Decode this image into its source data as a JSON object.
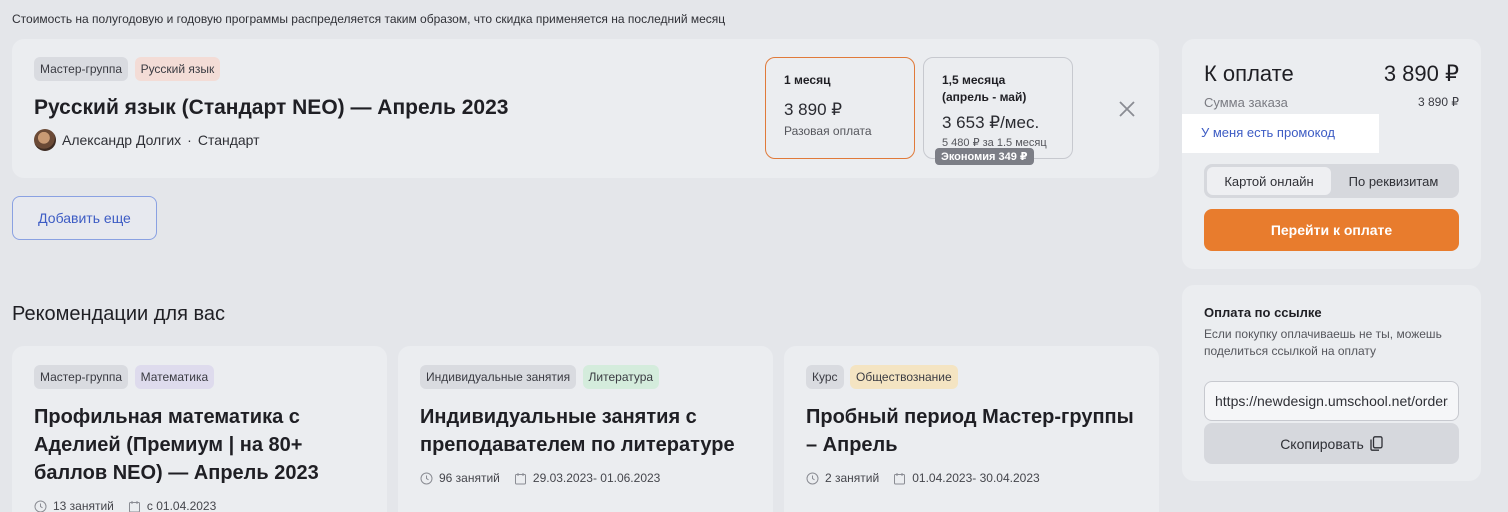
{
  "notice": "Стоимость на полугодовую и годовую программы распределяется таким образом, что скидка применяется на последний месяц",
  "cart_item": {
    "tags": [
      "Мастер-группа",
      "Русский язык"
    ],
    "title": "Русский язык (Стандарт NEO) — Апрель 2023",
    "author": "Александр Долгих",
    "separator": "·",
    "level": "Стандарт",
    "plans": [
      {
        "name": "1 месяц",
        "price": "3 890 ₽",
        "sub": "Разовая оплата"
      },
      {
        "name_line1": "1,5 месяца",
        "name_line2": "(апрель - май)",
        "price": "3 653 ₽/мес.",
        "sub": "5 480 ₽ за 1.5 месяц",
        "badge": "Экономия 349 ₽"
      }
    ]
  },
  "add_more": "Добавить еще",
  "recommendations": {
    "heading": "Рекомендации для вас",
    "cards": [
      {
        "tags": [
          "Мастер-группа",
          "Математика"
        ],
        "title": "Профильная математика с Аделией (Премиум | на 80+ баллов NEO) — Апрель 2023",
        "lessons": "13 занятий",
        "dates": "с 01.04.2023"
      },
      {
        "tags": [
          "Индивидуальные занятия",
          "Литература"
        ],
        "title": "Индивидуальные занятия с преподавателем по литературе",
        "lessons": "96 занятий",
        "dates": "29.03.2023- 01.06.2023"
      },
      {
        "tags": [
          "Курс",
          "Обществознание"
        ],
        "title": "Пробный период Мастер-группы – Апрель",
        "lessons": "2 занятий",
        "dates": "01.04.2023- 30.04.2023"
      }
    ]
  },
  "payment": {
    "title": "К оплате",
    "total": "3 890 ₽",
    "order_label": "Сумма заказа",
    "order_value": "3 890 ₽",
    "promo": "У меня есть промокод",
    "methods": [
      "Картой онлайн",
      "По реквизитам"
    ],
    "checkout": "Перейти к оплате"
  },
  "pay_link": {
    "title": "Оплата по ссылке",
    "description": "Если покупку оплачиваешь не ты, можешь поделиться ссылкой на оплату",
    "url": "https://newdesign.umschool.net/order/pay",
    "copy": "Скопировать"
  },
  "colors": {
    "accent": "#e87c2d",
    "link": "#3d5cc4",
    "background": "#e4e6ea",
    "card": "#ebedf0"
  }
}
